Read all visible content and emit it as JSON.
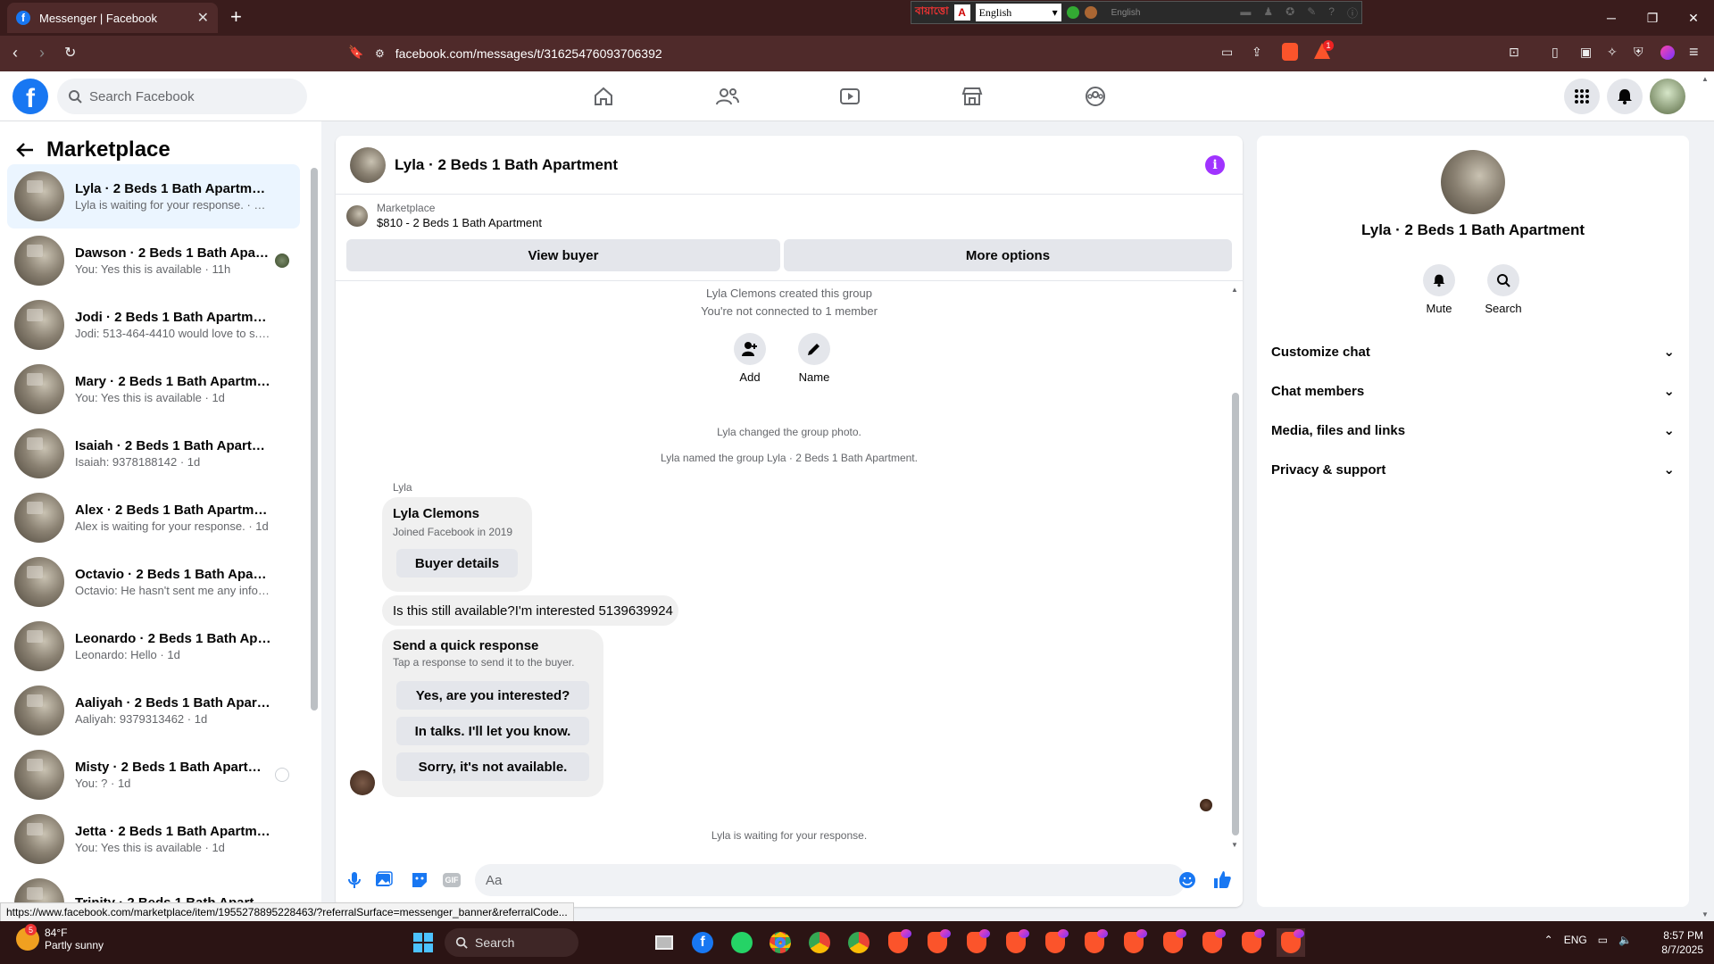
{
  "browser": {
    "tab_title": "Messenger | Facebook",
    "url": "facebook.com/messages/t/31625476093706392",
    "lang_text": "বায়াত্তো",
    "lang_select": "English",
    "lang_hint": "English",
    "brave_badge": "1"
  },
  "fb": {
    "search_placeholder": "Search Facebook"
  },
  "left": {
    "title": "Marketplace",
    "conversations": [
      {
        "name": "Lyla · 2 Beds 1 Bath Apartment",
        "preview": "Lyla is waiting for your response. · 10h"
      },
      {
        "name": "Dawson · 2 Beds 1 Bath Apartment",
        "preview": "You: Yes this is available · 11h"
      },
      {
        "name": "Jodi · 2 Beds 1 Bath Apartment",
        "preview": "Jodi: 513-464-4410 would love to s... · 1d"
      },
      {
        "name": "Mary · 2 Beds 1 Bath Apartment",
        "preview": "You: Yes this is available · 1d"
      },
      {
        "name": "Isaiah · 2 Beds 1 Bath Apartment",
        "preview": "Isaiah: 9378188142 · 1d"
      },
      {
        "name": "Alex · 2 Beds 1 Bath Apartment",
        "preview": "Alex is waiting for your response. · 1d"
      },
      {
        "name": "Octavio · 2 Beds 1 Bath Apartment",
        "preview": "Octavio: He hasn't sent me any info... · 1d"
      },
      {
        "name": "Leonardo · 2 Beds 1 Bath Apartment",
        "preview": "Leonardo: Hello · 1d"
      },
      {
        "name": "Aaliyah · 2 Beds 1 Bath Apartment",
        "preview": "Aaliyah: 9379313462 · 1d"
      },
      {
        "name": "Misty · 2 Beds 1 Bath Apartment",
        "preview": "You: ? · 1d"
      },
      {
        "name": "Jetta · 2 Beds 1 Bath Apartment",
        "preview": "You: Yes this is available · 1d"
      },
      {
        "name": "Trinity · 2 Beds 1 Bath Apartment",
        "preview": ""
      }
    ]
  },
  "chat": {
    "title": "Lyla · 2 Beds 1 Bath Apartment",
    "listing_label": "Marketplace",
    "listing_detail": "$810 - 2 Beds 1 Bath Apartment",
    "view_buyer": "View buyer",
    "more_options": "More options",
    "created": "Lyla Clemons created this group",
    "not_connected": "You're not connected to 1 member",
    "add_label": "Add",
    "name_label": "Name",
    "changed_photo": "Lyla changed the group photo.",
    "named_group": "Lyla named the group Lyla · 2 Beds 1 Bath Apartment.",
    "sender": "Lyla",
    "card_name": "Lyla Clemons",
    "card_joined": "Joined Facebook in 2019",
    "buyer_details": "Buyer details",
    "message": "Is this still available?I'm interested 5139639924",
    "quick_title": "Send a quick response",
    "quick_sub": "Tap a response to send it to the buyer.",
    "quick_responses": [
      "Yes, are you interested?",
      "In talks. I'll let you know.",
      "Sorry, it's not available."
    ],
    "waiting": "Lyla is waiting for your response.",
    "input_placeholder": "Aa"
  },
  "right": {
    "name": "Lyla · 2 Beds 1 Bath Apartment",
    "mute": "Mute",
    "search": "Search",
    "sections": [
      "Customize chat",
      "Chat members",
      "Media, files and links",
      "Privacy & support"
    ]
  },
  "status_url": "https://www.facebook.com/marketplace/item/1955278895228463/?referralSurface=messenger_banner&referralCode...",
  "taskbar": {
    "temp": "84°F",
    "weather": "Partly sunny",
    "weather_badge": "5",
    "search": "Search",
    "lang": "ENG",
    "time": "8:57 PM",
    "date": "8/7/2025"
  },
  "colors": {
    "accent": "#1877f2",
    "info": "#a033ff",
    "browser_bg": "#3a1c1c"
  }
}
